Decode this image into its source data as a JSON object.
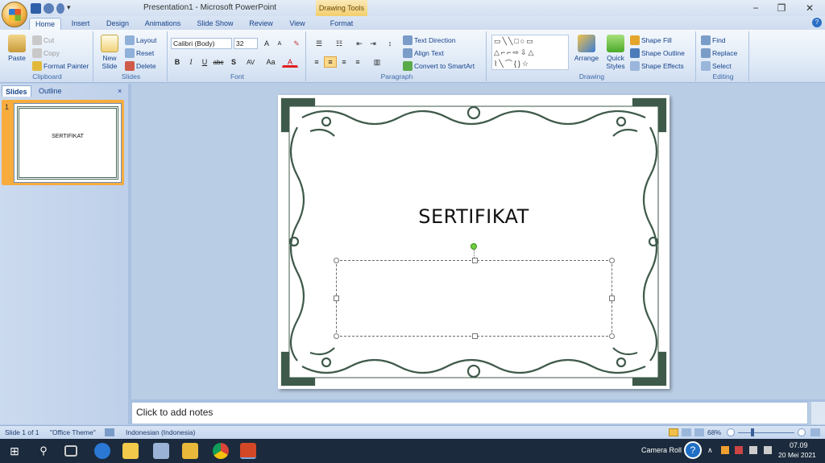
{
  "window": {
    "title": "Presentation1 - Microsoft PowerPoint",
    "context_tab_group": "Drawing Tools",
    "controls": [
      "−",
      "❐",
      "✕"
    ]
  },
  "tabs": [
    {
      "label": "Home",
      "active": true
    },
    {
      "label": "Insert"
    },
    {
      "label": "Design"
    },
    {
      "label": "Animations"
    },
    {
      "label": "Slide Show"
    },
    {
      "label": "Review"
    },
    {
      "label": "View"
    },
    {
      "label": "Format"
    }
  ],
  "ribbon": {
    "clipboard": {
      "label": "Clipboard",
      "paste": "Paste",
      "cut": "Cut",
      "copy": "Copy",
      "format_painter": "Format Painter"
    },
    "slides": {
      "label": "Slides",
      "new_slide": "New Slide",
      "layout": "Layout",
      "reset": "Reset",
      "delete": "Delete"
    },
    "font": {
      "label": "Font",
      "family": "Calibri (Body)",
      "size": "32",
      "bold": "B",
      "italic": "I",
      "underline": "U",
      "strike": "abc",
      "shadow": "S",
      "spacing": "AV",
      "case": "Aa",
      "color": "A"
    },
    "paragraph": {
      "label": "Paragraph",
      "text_direction": "Text Direction",
      "align_text": "Align Text",
      "convert_smartart": "Convert to SmartArt"
    },
    "drawing": {
      "label": "Drawing",
      "arrange": "Arrange",
      "quick_styles": "Quick Styles",
      "shape_fill": "Shape Fill",
      "shape_outline": "Shape Outline",
      "shape_effects": "Shape Effects"
    },
    "editing": {
      "label": "Editing",
      "find": "Find",
      "replace": "Replace",
      "select": "Select"
    }
  },
  "left_pane": {
    "tabs": [
      "Slides",
      "Outline"
    ],
    "close": "×",
    "slide_number": "1",
    "thumb_title": "SERTIFIKAT"
  },
  "slide": {
    "title": "SERTIFIKAT"
  },
  "notes": {
    "placeholder": "Click to add notes"
  },
  "status": {
    "slide": "Slide 1 of 1",
    "theme": "\"Office Theme\"",
    "language": "Indonesian (Indonesia)",
    "zoom": "68%"
  },
  "taskbar": {
    "camera_roll": "Camera Roll",
    "time": "07.09",
    "date": "20 Mei 2021"
  },
  "colors": {
    "accent": "#15428b",
    "ribbon": "#dde8f6",
    "thumb_selected": "#f7ac3c",
    "ornament": "#3f5a4a"
  }
}
